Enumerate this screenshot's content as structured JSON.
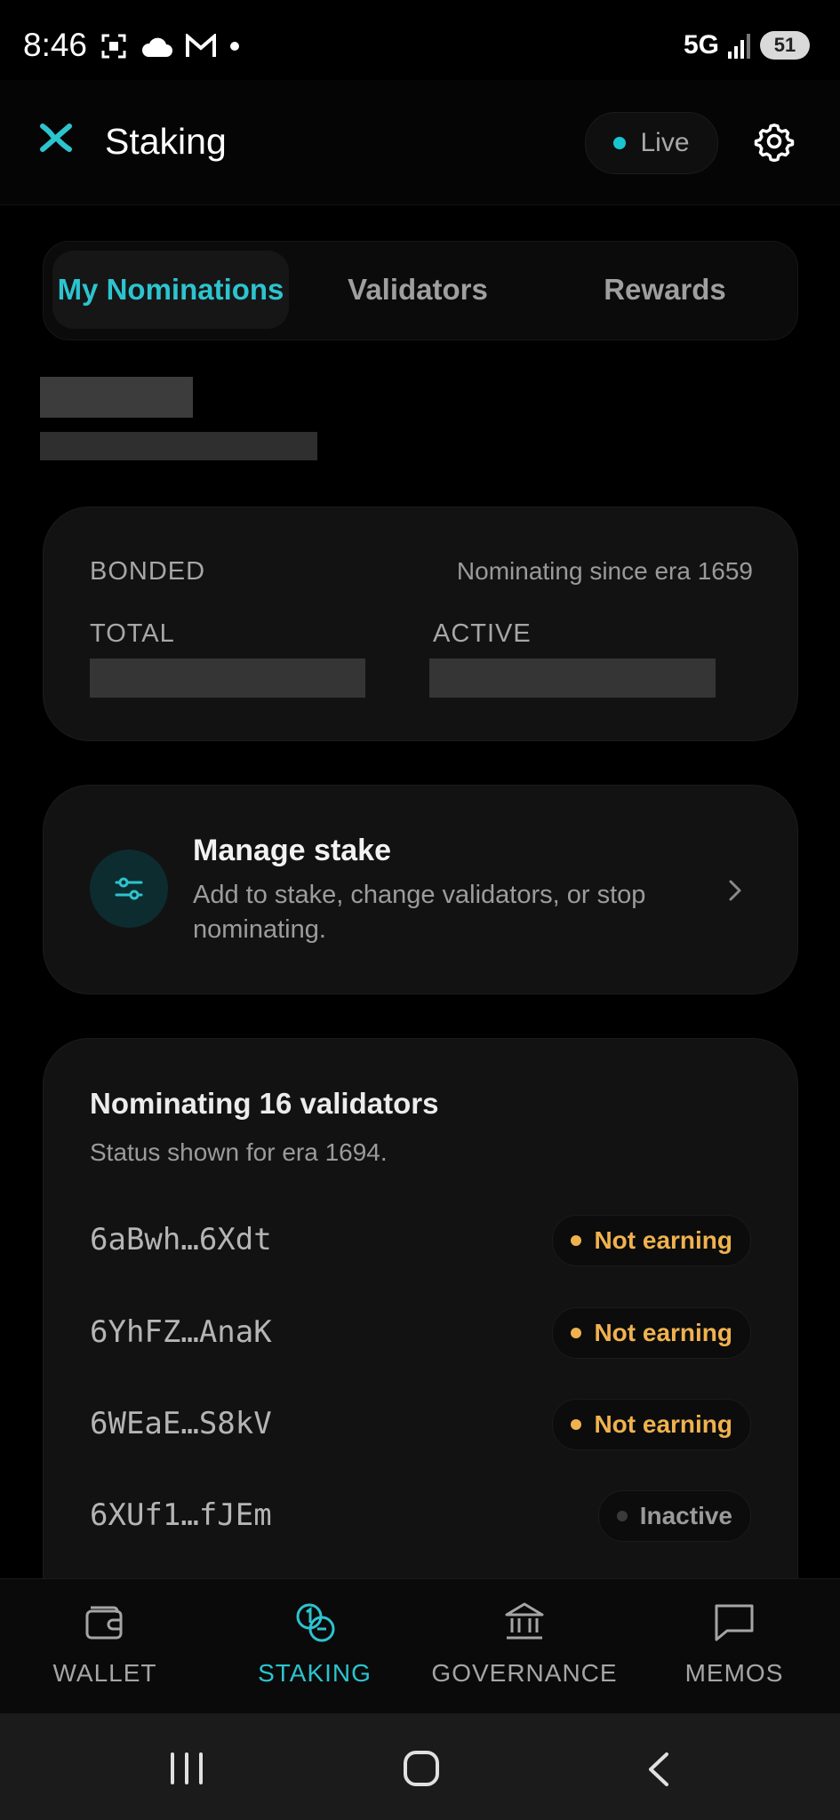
{
  "status_bar": {
    "time": "8:46",
    "network": "5G",
    "battery": "51"
  },
  "header": {
    "title": "Staking",
    "live_label": "Live"
  },
  "tabs": [
    {
      "label": "My Nominations",
      "active": true
    },
    {
      "label": "Validators",
      "active": false
    },
    {
      "label": "Rewards",
      "active": false
    }
  ],
  "summary": {
    "bonded_label": "BONDED",
    "since_text": "Nominating since era 1659",
    "total_label": "TOTAL",
    "active_label": "ACTIVE"
  },
  "manage": {
    "title": "Manage stake",
    "description": "Add to stake, change validators, or stop nominating."
  },
  "nominations": {
    "title": "Nominating 16 validators",
    "subtitle": "Status shown for era 1694.",
    "validators": [
      {
        "address": "6aBwh…6Xdt",
        "status": "Not earning",
        "kind": "warn"
      },
      {
        "address": "6YhFZ…AnaK",
        "status": "Not earning",
        "kind": "warn"
      },
      {
        "address": "6WEaE…S8kV",
        "status": "Not earning",
        "kind": "warn"
      },
      {
        "address": "6XUf1…fJEm",
        "status": "Inactive",
        "kind": "inactive"
      }
    ]
  },
  "bottom_nav": [
    {
      "label": "WALLET",
      "icon": "wallet-icon",
      "active": false
    },
    {
      "label": "STAKING",
      "icon": "staking-icon",
      "active": true
    },
    {
      "label": "GOVERNANCE",
      "icon": "governance-icon",
      "active": false
    },
    {
      "label": "MEMOS",
      "icon": "memos-icon",
      "active": false
    }
  ],
  "colors": {
    "accent": "#2cc4cf",
    "warning": "#f0b24e",
    "background": "#000000"
  }
}
